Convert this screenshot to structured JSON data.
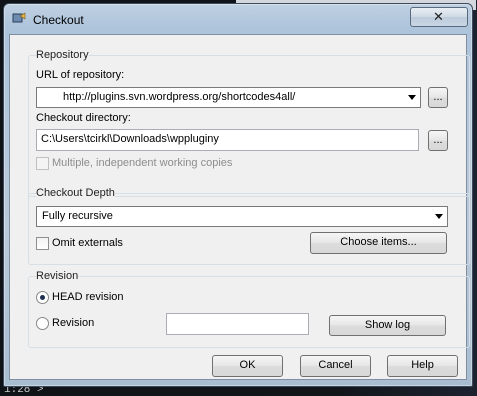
{
  "window": {
    "title": "Checkout",
    "close_glyph": "✕"
  },
  "repository": {
    "group_label": "Repository",
    "url_label": "URL of repository:",
    "url_value": "http://plugins.svn.wordpress.org/shortcodes4all/",
    "browse_label": "...",
    "dir_label": "Checkout directory:",
    "dir_value": "C:\\Users\\tcirkl\\Downloads\\wppluginy",
    "dir_browse_label": "...",
    "multiple_label": "Multiple, independent working copies"
  },
  "depth": {
    "group_label": "Checkout Depth",
    "selected": "Fully recursive",
    "omit_externals_label": "Omit externals",
    "choose_items_label": "Choose items..."
  },
  "revision": {
    "group_label": "Revision",
    "head_label": "HEAD revision",
    "revision_label": "Revision",
    "revision_value": "",
    "show_log_label": "Show log"
  },
  "buttons": {
    "ok": "OK",
    "cancel": "Cancel",
    "help": "Help"
  },
  "background": {
    "bottom_text": "1:28  >"
  },
  "colors": {
    "title_bar": "#aec4db",
    "dialog_face": "#f0f0f0"
  }
}
